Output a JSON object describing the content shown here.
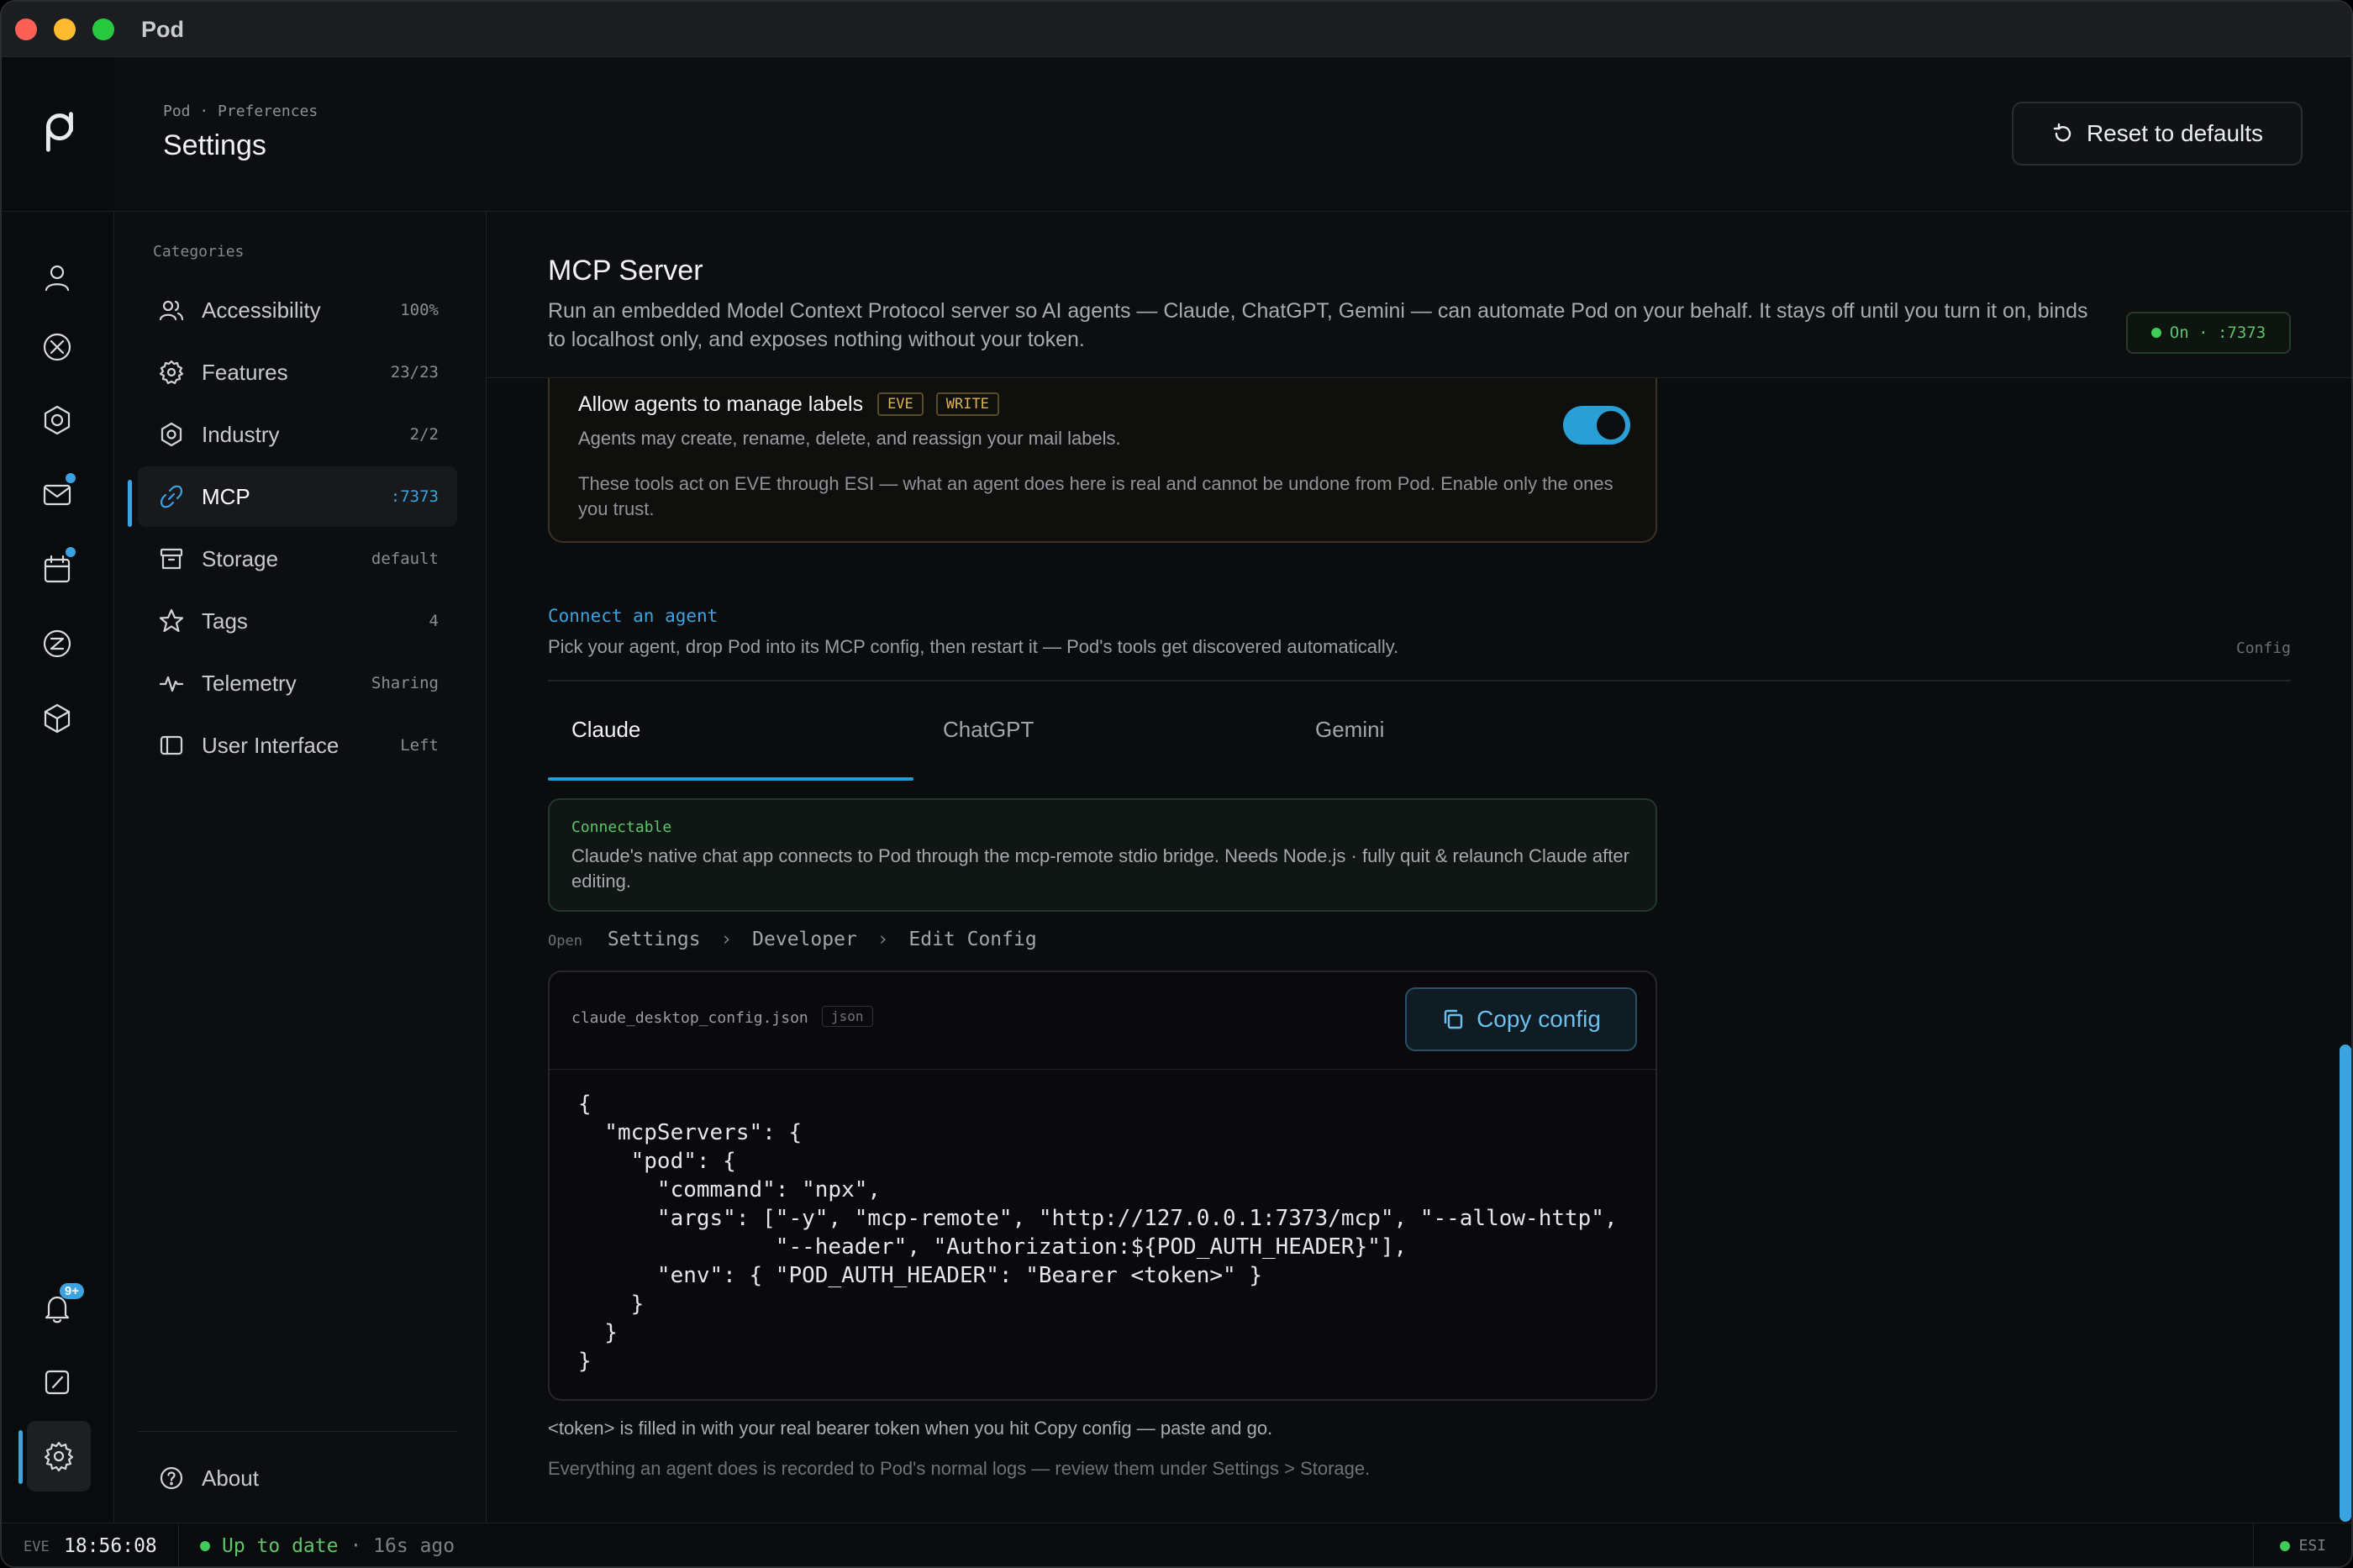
{
  "window": {
    "title": "Pod"
  },
  "header": {
    "breadcrumb": "Pod · Preferences",
    "title": "Settings",
    "reset_label": "Reset to defaults"
  },
  "rail": {
    "icons": [
      "user-icon",
      "circle-x-icon",
      "hexagon-icon",
      "mail-icon",
      "calendar-icon",
      "z-circle-icon",
      "cube-icon",
      "bell-icon",
      "edit-box-icon",
      "gear-icon"
    ],
    "bell_badge": "9+"
  },
  "sidebar": {
    "heading": "Categories",
    "items": [
      {
        "label": "Accessibility",
        "meta": "100%",
        "icon": "users-icon"
      },
      {
        "label": "Features",
        "meta": "23/23",
        "icon": "gear-badge-icon"
      },
      {
        "label": "Industry",
        "meta": "2/2",
        "icon": "hexagon-icon"
      },
      {
        "label": "MCP",
        "meta": ":7373",
        "icon": "link-icon"
      },
      {
        "label": "Storage",
        "meta": "default",
        "icon": "archive-icon"
      },
      {
        "label": "Tags",
        "meta": "4",
        "icon": "star-icon"
      },
      {
        "label": "Telemetry",
        "meta": "Sharing",
        "icon": "pulse-icon"
      },
      {
        "label": "User Interface",
        "meta": "Left",
        "icon": "sidebar-layout-icon"
      }
    ],
    "about": "About"
  },
  "section": {
    "title": "MCP Server",
    "description": "Run an embedded Model Context Protocol server so AI agents — Claude, ChatGPT, Gemini — can automate Pod on your behalf. It stays off until you turn it on, binds to localhost only, and exposes nothing without your token.",
    "status": "On · :7373"
  },
  "permission": {
    "title": "Allow agents to manage labels",
    "tags": [
      "EVE",
      "WRITE"
    ],
    "subtitle": "Agents may create, rename, delete, and reassign your mail labels.",
    "note": "These tools act on EVE through ESI — what an agent does here is real and cannot be undone from Pod. Enable only the ones you trust.",
    "enabled": true
  },
  "connect": {
    "label": "Connect an agent",
    "description": "Pick your agent, drop Pod into its MCP config, then restart it — Pod's tools get discovered automatically.",
    "config_label": "Config",
    "tabs": [
      "Claude",
      "ChatGPT",
      "Gemini"
    ],
    "active_tab": "Claude"
  },
  "info": {
    "label": "Connectable",
    "text": "Claude's native chat app connects to Pod through the mcp-remote stdio bridge. Needs Node.js · fully quit & relaunch Claude after editing."
  },
  "path": {
    "open": "Open",
    "steps": [
      "Settings",
      "Developer",
      "Edit Config"
    ]
  },
  "code": {
    "file_name": "claude_desktop_config.json",
    "file_type": "json",
    "copy_label": "Copy config",
    "content": "{\n  \"mcpServers\": {\n    \"pod\": {\n      \"command\": \"npx\",\n      \"args\": [\"-y\", \"mcp-remote\", \"http://127.0.0.1:7373/mcp\", \"--allow-http\",\n               \"--header\", \"Authorization:${POD_AUTH_HEADER}\"],\n      \"env\": { \"POD_AUTH_HEADER\": \"Bearer <token>\" }\n    }\n  }\n}"
  },
  "footnotes": {
    "token": "<token> is filled in with your real bearer token when you hit Copy config — paste and go.",
    "logs": "Everything an agent does is recorded to Pod's normal logs — review them under Settings > Storage."
  },
  "statusbar": {
    "eve_label": "EVE",
    "time": "18:56:08",
    "status": "Up to date",
    "ago": "· 16s ago",
    "esi": "ESI"
  },
  "colors": {
    "accent": "#3aa3e0",
    "ok": "#3ecb5a",
    "warn": "#e0b24a"
  }
}
